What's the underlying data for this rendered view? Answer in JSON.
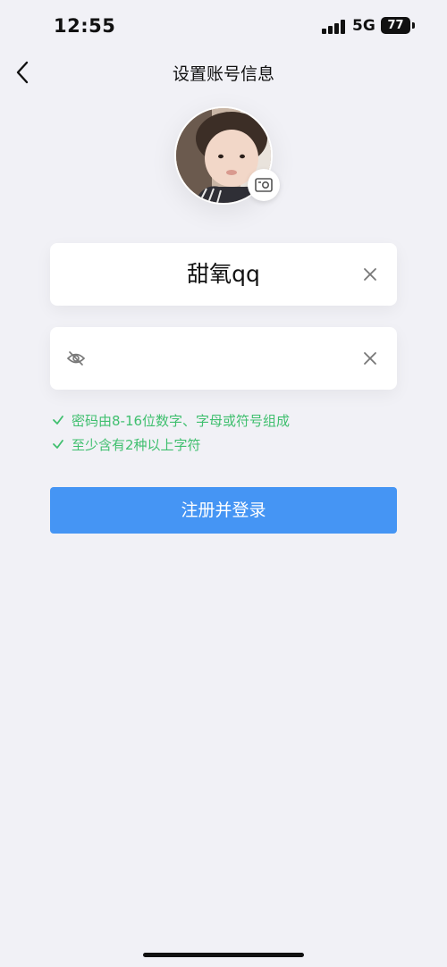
{
  "status_bar": {
    "time": "12:55",
    "network": "5G",
    "battery": "77"
  },
  "header": {
    "title": "设置账号信息"
  },
  "form": {
    "username_value": "甜氧qq",
    "password_value": "",
    "password_placeholder": ""
  },
  "rules": [
    {
      "text": "密码由8-16位数字、字母或符号组成",
      "satisfied": true
    },
    {
      "text": "至少含有2种以上字符",
      "satisfied": true
    }
  ],
  "submit_label": "注册并登录",
  "colors": {
    "accent": "#4595f4",
    "rule_ok": "#3fbf6e",
    "background": "#f1f1f6"
  },
  "icons": {
    "back": "chevron-left-icon",
    "camera": "camera-icon",
    "clear": "close-icon",
    "visibility": "eye-off-icon"
  }
}
